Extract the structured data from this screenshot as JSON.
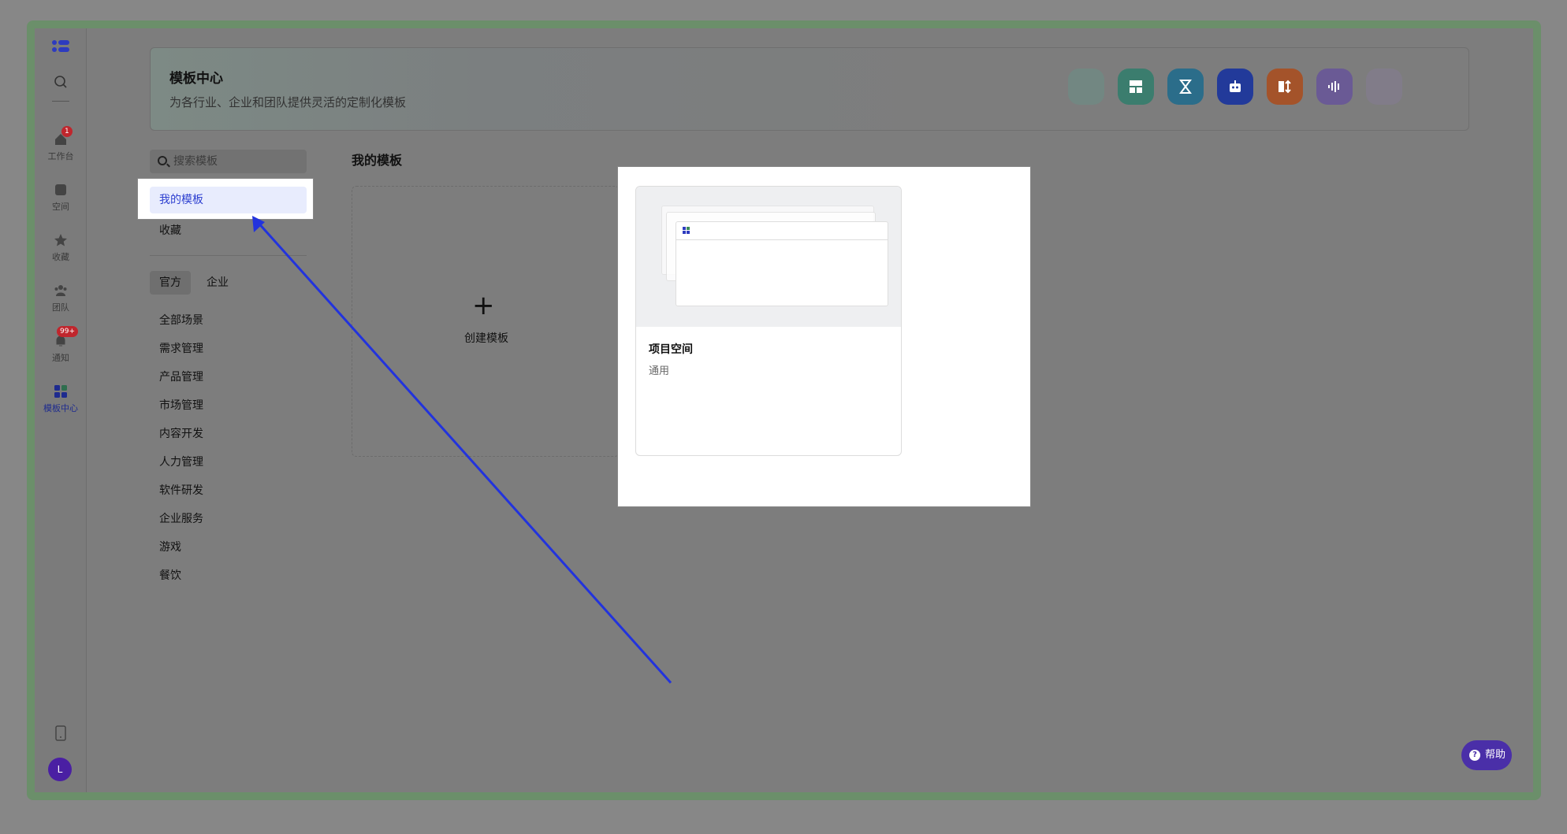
{
  "rail": {
    "items": [
      {
        "label": "",
        "icon": "search-icon"
      },
      {
        "label": "工作台",
        "icon": "home-icon",
        "badge": "1"
      },
      {
        "label": "空间",
        "icon": "space-icon"
      },
      {
        "label": "收藏",
        "icon": "star-icon"
      },
      {
        "label": "团队",
        "icon": "team-icon"
      },
      {
        "label": "通知",
        "icon": "bell-icon",
        "badge": "99+"
      },
      {
        "label": "模板中心",
        "icon": "template-icon",
        "active": true
      }
    ],
    "avatar": "L"
  },
  "banner": {
    "title": "模板中心",
    "subtitle": "为各行业、企业和团队提供灵活的定制化模板"
  },
  "sidebar": {
    "search_placeholder": "搜索模板",
    "my_templates": "我的模板",
    "favorites": "收藏",
    "tabs": [
      "官方",
      "企业"
    ],
    "categories": [
      "全部场景",
      "需求管理",
      "产品管理",
      "市场管理",
      "内容开发",
      "人力管理",
      "软件研发",
      "企业服务",
      "游戏",
      "餐饮"
    ]
  },
  "main": {
    "title": "我的模板",
    "create_label": "创建模板",
    "card": {
      "name": "项目空间",
      "category": "通用"
    }
  },
  "help_label": "帮助",
  "colors": {
    "accent": "#2d3fd0",
    "arrow": "#2233dd"
  }
}
